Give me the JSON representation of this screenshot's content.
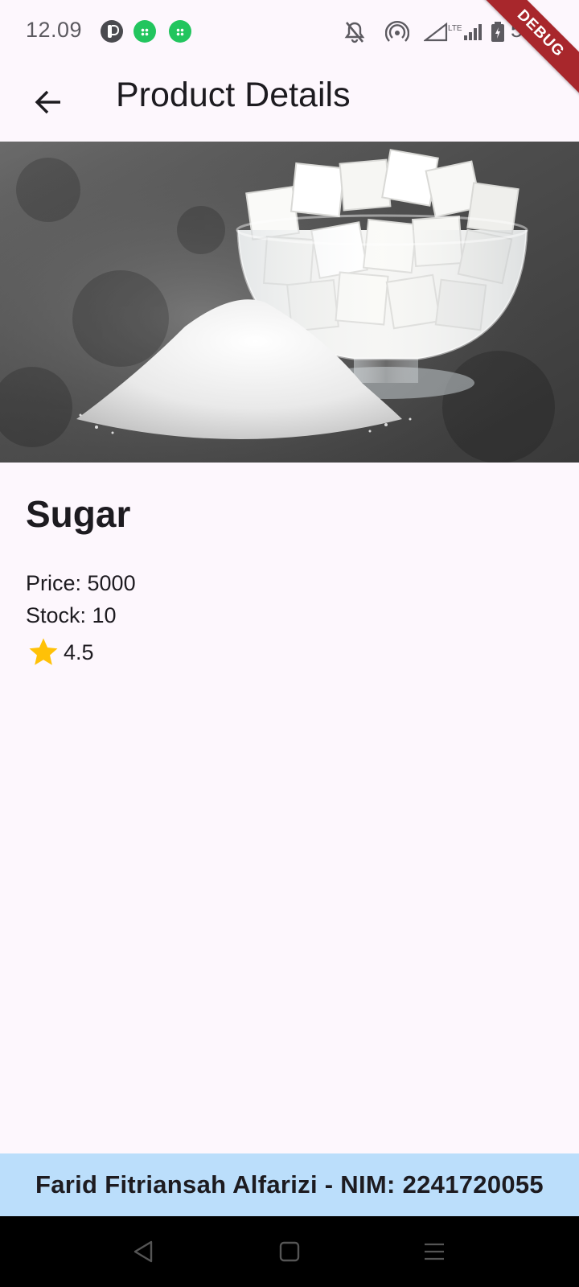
{
  "status_bar": {
    "time": "12.09",
    "battery_text": "5 %",
    "icons": [
      "app-icon-1",
      "app-icon-2",
      "app-icon-3",
      "bell-off-icon",
      "hotspot-icon",
      "signal-lte-icon",
      "battery-icon"
    ]
  },
  "debug_banner": "DEBUG",
  "app_bar": {
    "title": "Product Details",
    "back_icon": "arrow-left-icon"
  },
  "product": {
    "image_alt": "Sugar",
    "name": "Sugar",
    "price_label": "Price: 5000",
    "stock_label": "Stock: 10",
    "rating": "4.5",
    "rating_icon": "star-icon",
    "rating_color": "#ffc107"
  },
  "footer": {
    "text": "Farid Fitriansah Alfarizi - NIM: 2241720055",
    "background": "#bbdefb"
  },
  "nav_bar": {
    "icons": [
      "back-triangle-icon",
      "home-square-icon",
      "recents-menu-icon"
    ]
  }
}
